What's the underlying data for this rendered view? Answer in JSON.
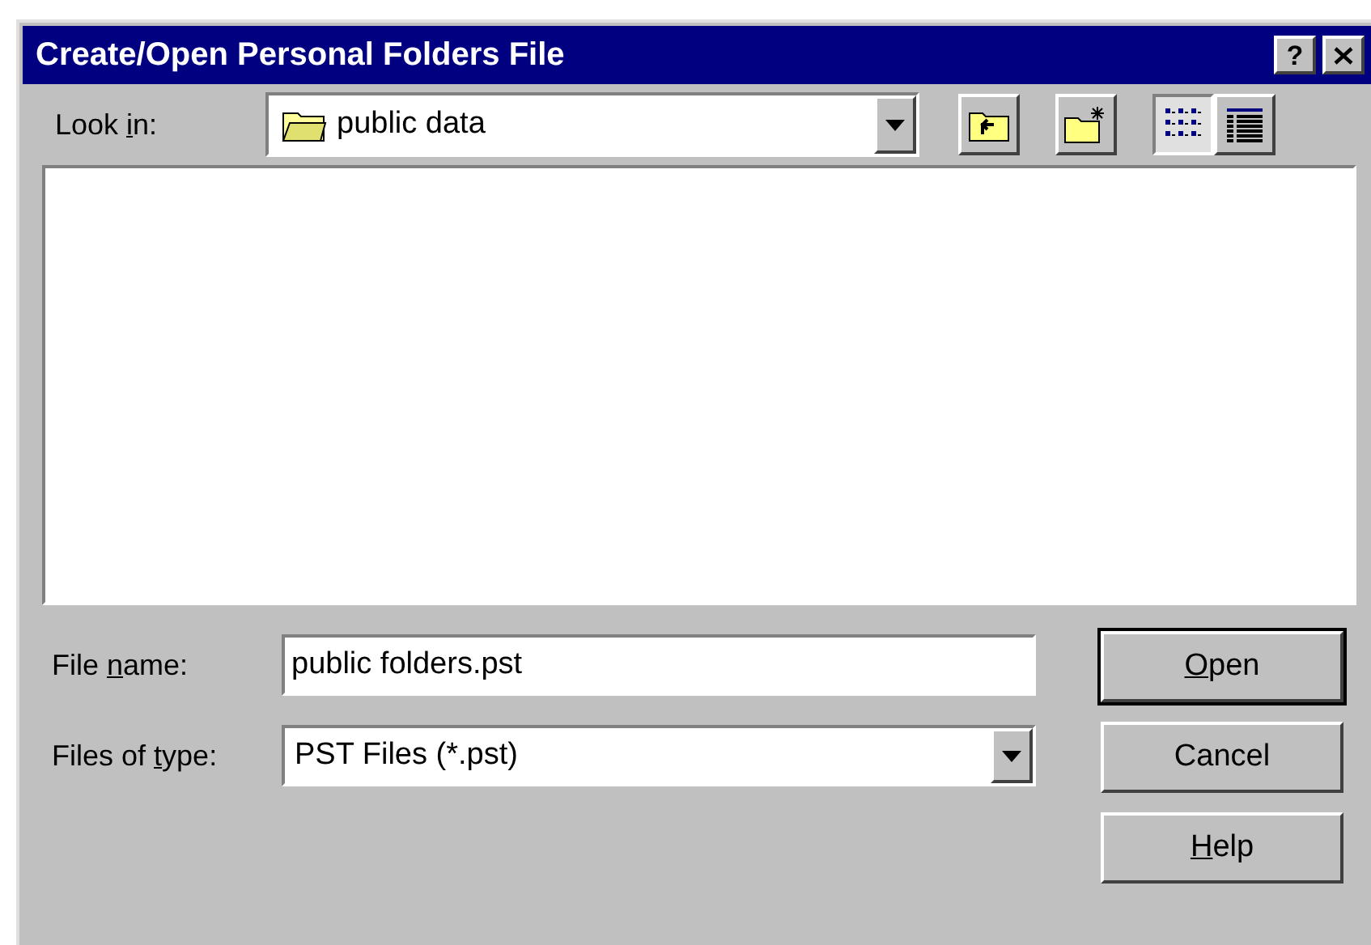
{
  "window": {
    "title": "Create/Open Personal Folders File",
    "title_buttons": [
      {
        "kind": "help",
        "label": "?"
      },
      {
        "kind": "close"
      }
    ]
  },
  "look_in": {
    "label": {
      "before": "Look ",
      "key": "i",
      "after": "n:"
    },
    "value": "public data"
  },
  "toolbar": [
    {
      "kind": "up",
      "selected": false
    },
    {
      "kind": "new-folder",
      "selected": false
    },
    {
      "kind": "list",
      "selected": true
    },
    {
      "kind": "details",
      "selected": false
    }
  ],
  "file_name": {
    "label": {
      "before": "File ",
      "key": "n",
      "after": "ame:"
    },
    "value": "public folders.pst"
  },
  "file_type": {
    "label": {
      "before": "Files of ",
      "key": "t",
      "after": "ype:"
    },
    "value": "PST Files (*.pst)"
  },
  "buttons": [
    {
      "label": {
        "key": "O",
        "after": "pen"
      },
      "default": true
    },
    {
      "label": {
        "before": "Cancel"
      },
      "default": false
    },
    {
      "label": {
        "key": "H",
        "after": "elp"
      },
      "default": false
    }
  ]
}
